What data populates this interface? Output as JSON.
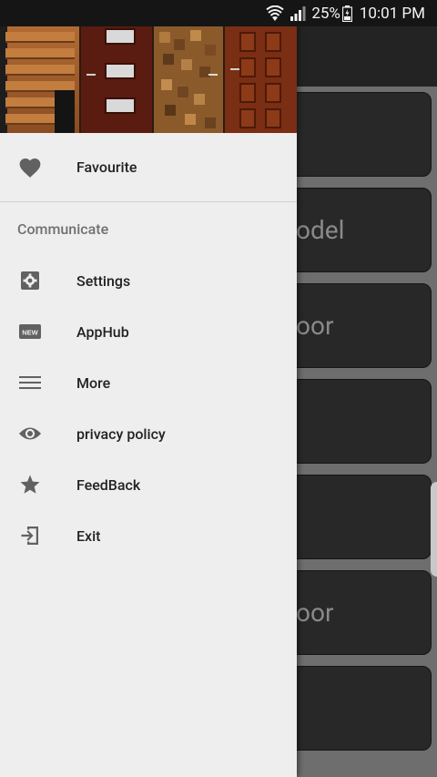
{
  "status_bar": {
    "battery": "25%",
    "time": "10:01 PM"
  },
  "background_cards": [
    "",
    "odel",
    "oor",
    "",
    "",
    "oor",
    ""
  ],
  "drawer": {
    "favourite_label": "Favourite",
    "section_header": "Communicate",
    "items": [
      {
        "label": "Settings",
        "icon": "settings-icon"
      },
      {
        "label": "AppHub",
        "icon": "new-badge-icon"
      },
      {
        "label": "More",
        "icon": "menu-lines-icon"
      },
      {
        "label": "privacy policy",
        "icon": "eye-icon"
      },
      {
        "label": "FeedBack",
        "icon": "star-icon"
      },
      {
        "label": "Exit",
        "icon": "exit-icon"
      }
    ]
  },
  "colors": {
    "drawer_bg": "#eeeeee",
    "icon": "#616161",
    "status_bar_bg": "#151515",
    "card_bg": "#282828"
  }
}
